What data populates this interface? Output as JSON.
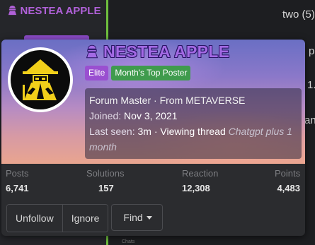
{
  "background": {
    "username": "NESTEA APPLE",
    "snippet_two": "two (5)",
    "snippet_p": "p",
    "snippet_one": "1.",
    "snippet_an": "an",
    "footer_label": "Chats"
  },
  "card": {
    "username": "NESTEA APPLE",
    "badges": [
      "Elite",
      "Month's Top Poster"
    ],
    "title_line": "Forum Master · From METAVERSE",
    "joined_label": "Joined:",
    "joined_value": "Nov 3, 2021",
    "last_seen_label": "Last seen:",
    "last_seen_value": "3m · Viewing thread",
    "last_seen_thread": "Chatgpt plus 1 month",
    "stats": [
      {
        "label": "Posts",
        "value": "6,741"
      },
      {
        "label": "Solutions",
        "value": "157"
      },
      {
        "label": "Reaction",
        "value": "12,308"
      },
      {
        "label": "Points",
        "value": "4,483"
      }
    ],
    "buttons": {
      "unfollow": "Unfollow",
      "ignore": "Ignore",
      "find": "Find"
    }
  },
  "colors": {
    "username_purple": "#a36ae4",
    "elite_badge": "#9a4fd0",
    "top_poster_badge": "#3f9b4d",
    "accent_green": "#6fbf3e"
  },
  "icons": {
    "username_prefix": "ninja-icon",
    "avatar": "wizard-logo"
  }
}
